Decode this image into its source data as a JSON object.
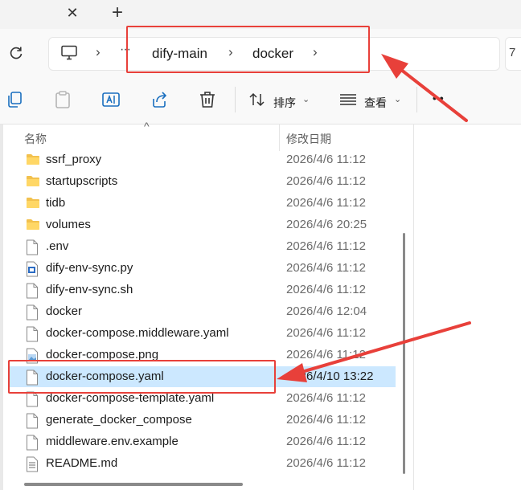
{
  "window": {
    "close_tab_glyph": "✕",
    "new_tab_glyph": "+"
  },
  "address": {
    "overflow_glyph": "···",
    "crumbs": [
      "dify-main",
      "docker"
    ],
    "partial_button": "7"
  },
  "toolbar": {
    "sort_label": "排序",
    "view_label": "查看",
    "more_glyph": "• •"
  },
  "list": {
    "header_name": "名称",
    "header_date": "修改日期",
    "files": [
      {
        "name": "ssrf_proxy",
        "date": "2026/4/6 11:12",
        "icon": "folder-icon"
      },
      {
        "name": "startupscripts",
        "date": "2026/4/6 11:12",
        "icon": "folder-icon"
      },
      {
        "name": "tidb",
        "date": "2026/4/6 11:12",
        "icon": "folder-icon"
      },
      {
        "name": "volumes",
        "date": "2026/4/6 20:25",
        "icon": "folder-icon"
      },
      {
        "name": ".env",
        "date": "2026/4/6 11:12",
        "icon": "file-icon"
      },
      {
        "name": "dify-env-sync.py",
        "date": "2026/4/6 11:12",
        "icon": "python-file-icon"
      },
      {
        "name": "dify-env-sync.sh",
        "date": "2026/4/6 11:12",
        "icon": "file-icon"
      },
      {
        "name": "docker",
        "date": "2026/4/6 12:04",
        "icon": "file-icon"
      },
      {
        "name": "docker-compose.middleware.yaml",
        "date": "2026/4/6 11:12",
        "icon": "file-icon"
      },
      {
        "name": "docker-compose.png",
        "date": "2026/4/6 11:12",
        "icon": "image-file-icon"
      },
      {
        "name": "docker-compose.yaml",
        "date": "2026/4/10 13:22",
        "icon": "file-icon",
        "selected": true
      },
      {
        "name": "docker-compose-template.yaml",
        "date": "2026/4/6 11:12",
        "icon": "file-icon"
      },
      {
        "name": "generate_docker_compose",
        "date": "2026/4/6 11:12",
        "icon": "file-icon"
      },
      {
        "name": "middleware.env.example",
        "date": "2026/4/6 11:12",
        "icon": "file-icon"
      },
      {
        "name": "README.md",
        "date": "2026/4/6 11:12",
        "icon": "text-file-icon"
      }
    ]
  },
  "annotation_color": "#e8403a",
  "selection_color": "#cce8ff"
}
